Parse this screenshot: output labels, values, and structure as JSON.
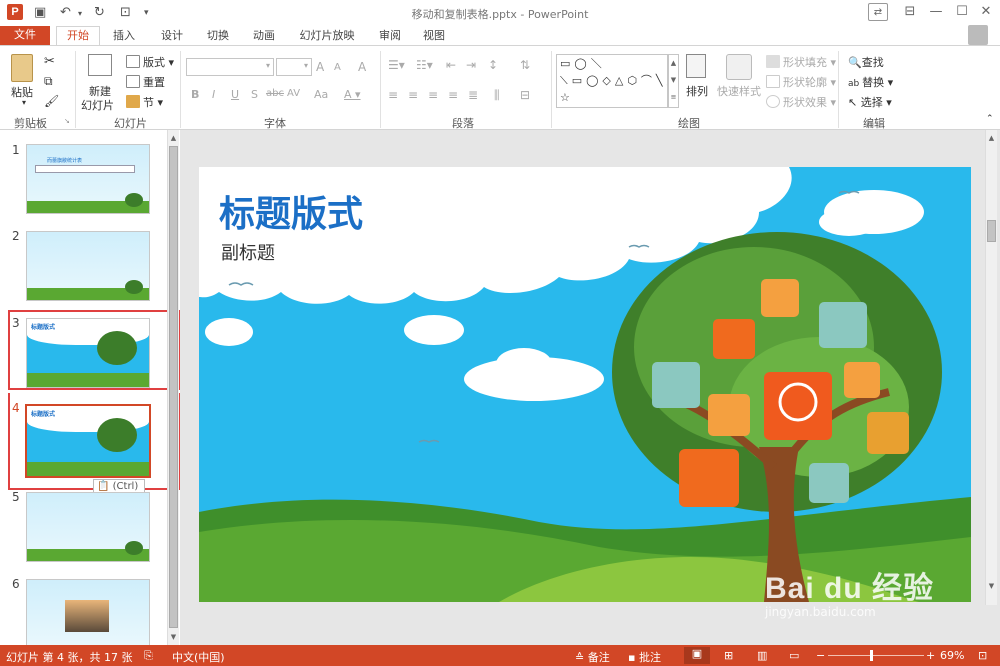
{
  "titlebar": {
    "title": "移动和复制表格.pptx - PowerPoint",
    "app_icon": "P"
  },
  "tabs": [
    {
      "label": "文件"
    },
    {
      "label": "开始"
    },
    {
      "label": "插入"
    },
    {
      "label": "设计"
    },
    {
      "label": "切换"
    },
    {
      "label": "动画"
    },
    {
      "label": "幻灯片放映"
    },
    {
      "label": "审阅"
    },
    {
      "label": "视图"
    }
  ],
  "ribbon": {
    "clipboard": {
      "paste": "粘贴",
      "group": "剪贴板"
    },
    "slides": {
      "new_slide": "新建",
      "new_slide_2": "幻灯片",
      "layout": "版式",
      "reset": "重置",
      "section": "节",
      "group": "幻灯片"
    },
    "font": {
      "group": "字体",
      "bold": "B",
      "italic": "I",
      "underline": "U",
      "shadow": "S",
      "strike": "abc",
      "spacing": "AV",
      "case": "Aa",
      "grow": "A",
      "shrink": "A",
      "clear": "A"
    },
    "paragraph": {
      "group": "段落"
    },
    "drawing": {
      "arrange": "排列",
      "quick_styles": "快速样式",
      "shape_fill": "形状填充",
      "shape_outline": "形状轮廓",
      "shape_effects": "形状效果",
      "group": "绘图",
      "shapes": "▭◯＼⟍▭◯◇△⬡⌒╲⤴⇨⬭☐↩∿⌢{}☆"
    },
    "editing": {
      "find": "查找",
      "replace": "替换",
      "select": "选择",
      "group": "编辑"
    }
  },
  "thumbnails": [
    {
      "num": "1",
      "text": "而蕾旗敝统计表"
    },
    {
      "num": "2",
      "text": ""
    },
    {
      "num": "3",
      "text": "标题版式"
    },
    {
      "num": "4",
      "text": "标题版式"
    },
    {
      "num": "5",
      "text": ""
    },
    {
      "num": "6",
      "text": ""
    }
  ],
  "paste_badge": "(Ctrl)",
  "slide": {
    "title": "标题版式",
    "subtitle": "副标题"
  },
  "status": {
    "slide_info": "幻灯片 第 4 张，共 17 张",
    "language": "中文(中国)",
    "notes": "备注",
    "comments": "批注",
    "zoom": "69%"
  },
  "watermark": {
    "brand": "Bai du 经验",
    "url": "jingyan.baidu.com"
  },
  "colors": {
    "accent": "#d24726",
    "title_blue": "#1b6fc6",
    "sky": "#29b9ec",
    "grass": "#5aa832"
  }
}
